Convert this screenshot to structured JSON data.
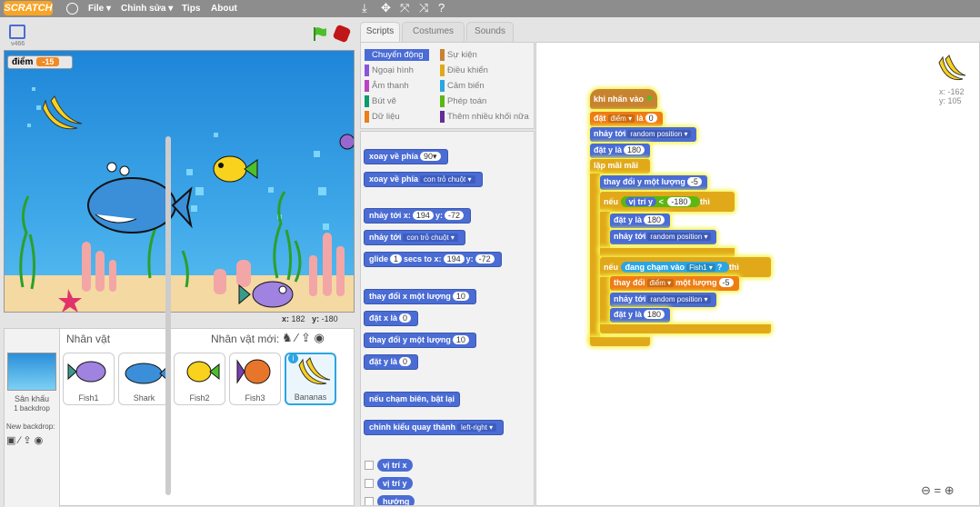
{
  "menu": {
    "file": "File ▾",
    "edit": "Chỉnh sửa ▾",
    "tips": "Tips",
    "about": "About",
    "logo": "SCRATCH"
  },
  "stage": {
    "version": "v466",
    "score_label": "điểm",
    "score_value": "-15",
    "x_label": "x:",
    "x_value": "182",
    "y_label": "y:",
    "y_value": "-180"
  },
  "sprites": {
    "header": "Nhân vật",
    "new_label": "Nhân vật mới:",
    "stage_label": "Sân khấu",
    "stage_backdrops": "1 backdrop",
    "new_backdrop": "New backdrop:",
    "items": [
      {
        "name": "Fish1"
      },
      {
        "name": "Shark"
      },
      {
        "name": "Fish2"
      },
      {
        "name": "Fish3"
      },
      {
        "name": "Bananas"
      }
    ]
  },
  "tabs": {
    "scripts": "Scripts",
    "costumes": "Costumes",
    "sounds": "Sounds"
  },
  "categories": [
    {
      "label": "Chuyển động",
      "color": "#4a6cd4"
    },
    {
      "label": "Ngoại hình",
      "color": "#8a55d7"
    },
    {
      "label": "Âm thanh",
      "color": "#bb42c3"
    },
    {
      "label": "Bút vẽ",
      "color": "#0e9a6c"
    },
    {
      "label": "Dữ liệu",
      "color": "#ee7d16"
    },
    {
      "label": "Sự kiện",
      "color": "#c88330"
    },
    {
      "label": "Điều khiển",
      "color": "#e1a91a"
    },
    {
      "label": "Cảm biến",
      "color": "#2ca5e2"
    },
    {
      "label": "Phép toán",
      "color": "#5cb712"
    },
    {
      "label": "Thêm nhiều khối nữa",
      "color": "#632d99"
    }
  ],
  "palette": {
    "b1": "xoay về phía",
    "b1v": "90▾",
    "b2": "xoay về phía",
    "b2v": "con trỏ chuột ▾",
    "b3": "nhảy tới x:",
    "b3x": "194",
    "b3y_label": "y:",
    "b3y": "-72",
    "b4": "nhảy tới",
    "b4v": "con trỏ chuột ▾",
    "b5": "glide",
    "b5a": "1",
    "b5b": "secs to x:",
    "b5x": "194",
    "b5y_label": "y:",
    "b5y": "-72",
    "b6": "thay đổi x một lượng",
    "b6v": "10",
    "b7": "đặt x là",
    "b7v": "0",
    "b8": "thay đổi y một lượng",
    "b8v": "10",
    "b9": "đặt y là",
    "b9v": "0",
    "b10": "nếu chạm biên, bật lại",
    "b11": "chỉnh kiểu quay thành",
    "b11v": "left-right ▾",
    "r1": "vị trí x",
    "r2": "vị trí y",
    "r3": "hướng"
  },
  "script": {
    "hat": "khi nhấn vào",
    "s1": "đặt",
    "s1v": "điểm ▾",
    "s1b": "là",
    "s1c": "0",
    "s2": "nhảy tới",
    "s2v": "random position ▾",
    "s3": "đặt y là",
    "s3v": "180",
    "loop": "lặp mãi mãi",
    "s4": "thay đổi y một lượng",
    "s4v": "-5",
    "if1": "nếu",
    "if1a": "vị trí y",
    "if1op": "<",
    "if1b": "-180",
    "if1then": "thì",
    "s5": "đặt y là",
    "s5v": "180",
    "s6": "nhảy tới",
    "s6v": "random position ▾",
    "if2": "nếu",
    "if2a": "đang chạm vào",
    "if2b": "Fish1 ▾",
    "if2q": "?",
    "if2then": "thì",
    "s7": "thay đổi",
    "s7v": "điểm ▾",
    "s7b": "một lượng",
    "s7c": "-5",
    "s8": "nhảy tới",
    "s8v": "random position ▾",
    "s9": "đặt y là",
    "s9v": "180"
  },
  "sprite_info": {
    "x": "x: -162",
    "y": "y: 105"
  }
}
